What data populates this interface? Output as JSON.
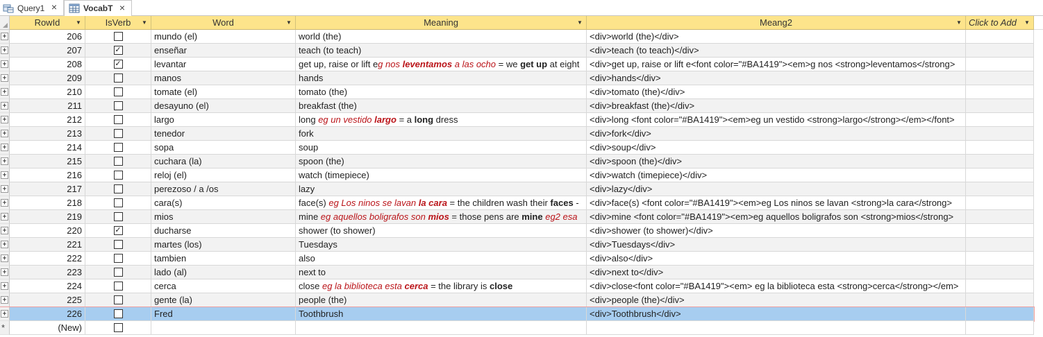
{
  "tabs": [
    {
      "label": "Query1",
      "icon": "query-icon",
      "active": false
    },
    {
      "label": "VocabT",
      "icon": "table-icon",
      "active": true
    }
  ],
  "columns": {
    "rowid": "RowId",
    "isverb": "IsVerb",
    "word": "Word",
    "meaning": "Meaning",
    "meang2": "Meang2",
    "click_to_add": "Click to Add"
  },
  "accent_color": "#BA1419",
  "header_color": "#FDE48B",
  "selected_row_color": "#A7CDF0",
  "rows": [
    {
      "id": "206",
      "isverb": false,
      "word": "mundo (el)",
      "meaning": [
        {
          "t": "world (the)"
        }
      ],
      "meang2": "<div>world (the)</div>"
    },
    {
      "id": "207",
      "isverb": true,
      "word": "enseñar",
      "meaning": [
        {
          "t": "teach (to teach)"
        }
      ],
      "meang2": "<div>teach (to teach)</div>"
    },
    {
      "id": "208",
      "isverb": true,
      "word": "levantar",
      "meaning": [
        {
          "t": "get up, raise or lift e"
        },
        {
          "t": "g nos ",
          "s": "red"
        },
        {
          "t": "leventamos",
          "s": "red b"
        },
        {
          "t": " a las ocho",
          "s": "red"
        },
        {
          "t": " = we "
        },
        {
          "t": "get up",
          "s": "b"
        },
        {
          "t": " at eight"
        }
      ],
      "meang2": "<div>get up, raise or lift e<font color=\"#BA1419\"><em>g nos <strong>leventamos</strong>"
    },
    {
      "id": "209",
      "isverb": false,
      "word": "manos",
      "meaning": [
        {
          "t": "hands"
        }
      ],
      "meang2": "<div>hands</div>"
    },
    {
      "id": "210",
      "isverb": false,
      "word": "tomate (el)",
      "meaning": [
        {
          "t": "tomato (the)"
        }
      ],
      "meang2": "<div>tomato (the)</div>"
    },
    {
      "id": "211",
      "isverb": false,
      "word": "desayuno (el)",
      "meaning": [
        {
          "t": "breakfast (the)"
        }
      ],
      "meang2": "<div>breakfast (the)</div>"
    },
    {
      "id": "212",
      "isverb": false,
      "word": "largo",
      "meaning": [
        {
          "t": "long "
        },
        {
          "t": "eg un vestido ",
          "s": "red"
        },
        {
          "t": "largo",
          "s": "red b"
        },
        {
          "t": " = a "
        },
        {
          "t": "long",
          "s": "b"
        },
        {
          "t": " dress"
        }
      ],
      "meang2": "<div>long <font color=\"#BA1419\"><em>eg un vestido <strong>largo</strong></em></font>"
    },
    {
      "id": "213",
      "isverb": false,
      "word": "tenedor",
      "meaning": [
        {
          "t": "fork"
        }
      ],
      "meang2": "<div>fork</div>"
    },
    {
      "id": "214",
      "isverb": false,
      "word": "sopa",
      "meaning": [
        {
          "t": "soup"
        }
      ],
      "meang2": "<div>soup</div>"
    },
    {
      "id": "215",
      "isverb": false,
      "word": "cuchara (la)",
      "meaning": [
        {
          "t": "spoon (the)"
        }
      ],
      "meang2": "<div>spoon (the)</div>"
    },
    {
      "id": "216",
      "isverb": false,
      "word": "reloj (el)",
      "meaning": [
        {
          "t": "watch (timepiece)"
        }
      ],
      "meang2": "<div>watch (timepiece)</div>"
    },
    {
      "id": "217",
      "isverb": false,
      "word": "perezoso / a /os",
      "meaning": [
        {
          "t": "lazy"
        }
      ],
      "meang2": "<div>lazy</div>"
    },
    {
      "id": "218",
      "isverb": false,
      "word": "cara(s)",
      "meaning": [
        {
          "t": "face(s) "
        },
        {
          "t": "eg Los ninos se lavan ",
          "s": "red"
        },
        {
          "t": "la cara",
          "s": "red b"
        },
        {
          "t": " = the children wash their "
        },
        {
          "t": "faces",
          "s": "b"
        },
        {
          "t": " -"
        }
      ],
      "meang2": "<div>face(s) <font color=\"#BA1419\"><em>eg Los ninos se lavan <strong>la cara</strong>"
    },
    {
      "id": "219",
      "isverb": false,
      "word": "mios",
      "meaning": [
        {
          "t": "mine "
        },
        {
          "t": "eg aquellos boligrafos son ",
          "s": "red"
        },
        {
          "t": "mios",
          "s": "red b"
        },
        {
          "t": " = those pens are "
        },
        {
          "t": "mine",
          "s": "b"
        },
        {
          "t": " "
        },
        {
          "t": "eg2 esa",
          "s": "red"
        }
      ],
      "meang2": "<div>mine <font color=\"#BA1419\"><em>eg aquellos boligrafos son <strong>mios</strong>"
    },
    {
      "id": "220",
      "isverb": true,
      "word": "ducharse",
      "meaning": [
        {
          "t": "shower (to shower)"
        }
      ],
      "meang2": "<div>shower (to shower)</div>"
    },
    {
      "id": "221",
      "isverb": false,
      "word": "martes (los)",
      "meaning": [
        {
          "t": "Tuesdays"
        }
      ],
      "meang2": "<div>Tuesdays</div>"
    },
    {
      "id": "222",
      "isverb": false,
      "word": "tambien",
      "meaning": [
        {
          "t": "also"
        }
      ],
      "meang2": "<div>also</div>"
    },
    {
      "id": "223",
      "isverb": false,
      "word": "lado (al)",
      "meaning": [
        {
          "t": "next to"
        }
      ],
      "meang2": "<div>next to</div>"
    },
    {
      "id": "224",
      "isverb": false,
      "word": "cerca",
      "meaning": [
        {
          "t": "close "
        },
        {
          "t": "eg la biblioteca esta ",
          "s": "red"
        },
        {
          "t": "cerca",
          "s": "red b"
        },
        {
          "t": " = the library is "
        },
        {
          "t": "close",
          "s": "b"
        }
      ],
      "meang2": "<div>close<font color=\"#BA1419\"><em> eg la biblioteca esta <strong>cerca</strong></em>"
    },
    {
      "id": "225",
      "isverb": false,
      "word": "gente (la)",
      "meaning": [
        {
          "t": "people (the)"
        }
      ],
      "meang2": "<div>people (the)</div>"
    },
    {
      "id": "226",
      "isverb": false,
      "word": "Fred",
      "meaning": [
        {
          "t": "Toothbrush"
        }
      ],
      "meang2": "<div>Toothbrush</div>",
      "selected": true
    }
  ],
  "new_row": {
    "id_label": "(New)",
    "star": "*"
  }
}
